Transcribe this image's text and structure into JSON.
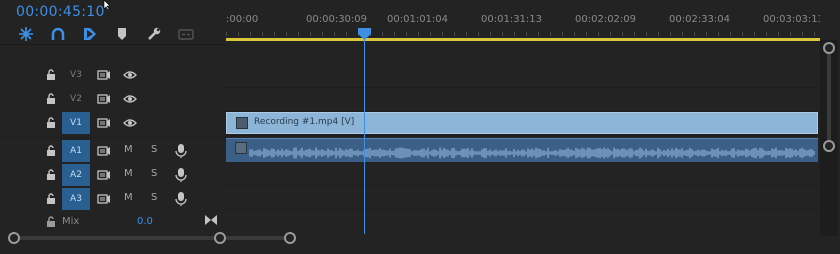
{
  "timecode": "00:00:45:10",
  "toolbar": {
    "tools": [
      "snap-icon",
      "linked-selection-icon",
      "insert-mark-icon",
      "add-marker-icon",
      "wrench-icon",
      "captions-icon"
    ]
  },
  "ruler": {
    "labels": [
      ":00:00",
      "00:00:30:09",
      "00:01:01:04",
      "00:01:31:13",
      "00:02:02:09",
      "00:02:33:04",
      "00:03:03:13"
    ]
  },
  "tracks": {
    "video": [
      {
        "name": "V3",
        "targeted": false
      },
      {
        "name": "V2",
        "targeted": false
      },
      {
        "name": "V1",
        "targeted": true
      }
    ],
    "audio": [
      {
        "name": "A1",
        "targeted": true,
        "mute": "M",
        "solo": "S"
      },
      {
        "name": "A2",
        "targeted": true,
        "mute": "M",
        "solo": "S"
      },
      {
        "name": "A3",
        "targeted": true,
        "mute": "M",
        "solo": "S"
      }
    ]
  },
  "mix": {
    "label": "Mix",
    "value": "0.0"
  },
  "clips": {
    "video": {
      "name": "Recording #1.mp4 [V]"
    }
  },
  "colors": {
    "accent": "#3d8fe6",
    "video_clip": "#8cb5d8",
    "audio_clip": "#3b5f86",
    "work_area": "#d9c63a"
  }
}
